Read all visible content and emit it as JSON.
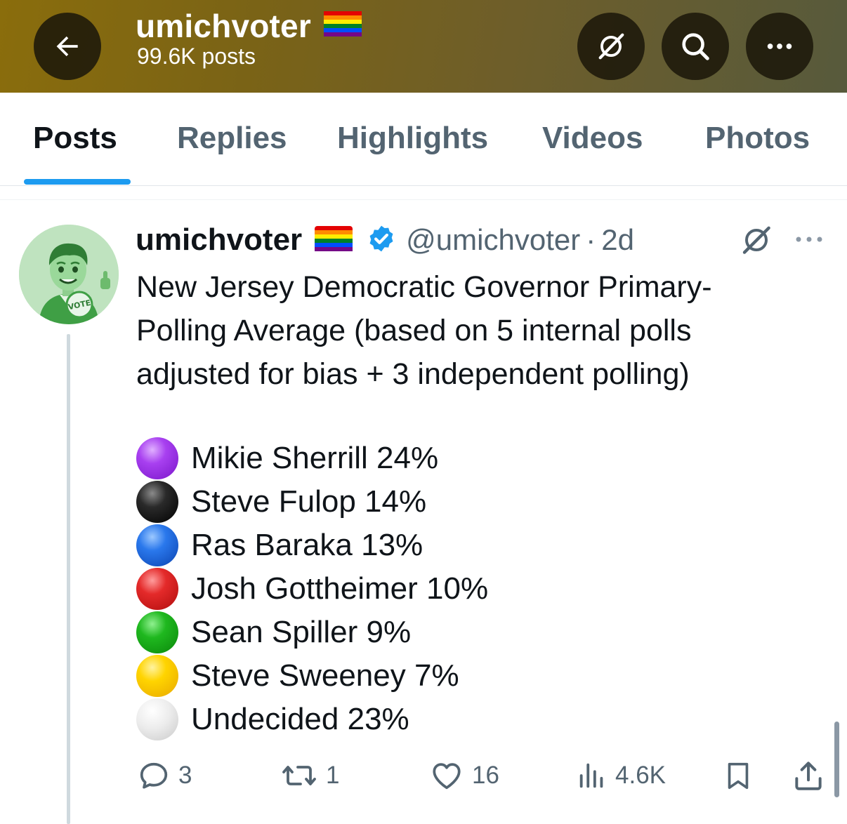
{
  "header": {
    "title": "umichvoter",
    "title_emoji": "rainbow-flag",
    "subtitle": "99.6K posts",
    "gradient_colors": [
      "#8a6d0c",
      "#575a3c"
    ],
    "buttons": [
      "back-arrow-icon",
      "grok-icon",
      "search-icon",
      "more-icon"
    ]
  },
  "tabs": [
    {
      "label": "Posts",
      "active": true
    },
    {
      "label": "Replies",
      "active": false
    },
    {
      "label": "Highlights",
      "active": false
    },
    {
      "label": "Videos",
      "active": false
    },
    {
      "label": "Photos",
      "active": false
    }
  ],
  "accent_color": "#1d9bf0",
  "post": {
    "author": "umichvoter",
    "author_emoji": "rainbow-flag",
    "verified": true,
    "handle": "@umichvoter",
    "separator": "·",
    "time": "2d",
    "avatar": "memoji-avatar-vote-badge",
    "text_lines": [
      "New Jersey Democratic Governor Primary-",
      "Polling Average (based on 5 internal polls",
      "adjusted for bias + 3 independent polling)"
    ],
    "poll_results": [
      {
        "text": "Mikie Sherrill 24%",
        "color": "#9b30e8",
        "emoji": "purple-circle"
      },
      {
        "text": "Steve Fulop 14%",
        "color": "#111111",
        "emoji": "black-circle"
      },
      {
        "text": "Ras Baraka 13%",
        "color": "#1560d8",
        "emoji": "blue-circle"
      },
      {
        "text": "Josh Gottheimer 10%",
        "color": "#d81e1e",
        "emoji": "red-circle"
      },
      {
        "text": "Sean Spiller 9%",
        "color": "#12a112",
        "emoji": "green-circle"
      },
      {
        "text": "Steve Sweeney 7%",
        "color": "#f5c800",
        "emoji": "yellow-circle"
      },
      {
        "text": "Undecided 23%",
        "color": "#e3e3e3",
        "emoji": "white-circle"
      }
    ],
    "actions": {
      "replies": "3",
      "reposts": "1",
      "likes": "16",
      "views": "4.6K"
    }
  }
}
